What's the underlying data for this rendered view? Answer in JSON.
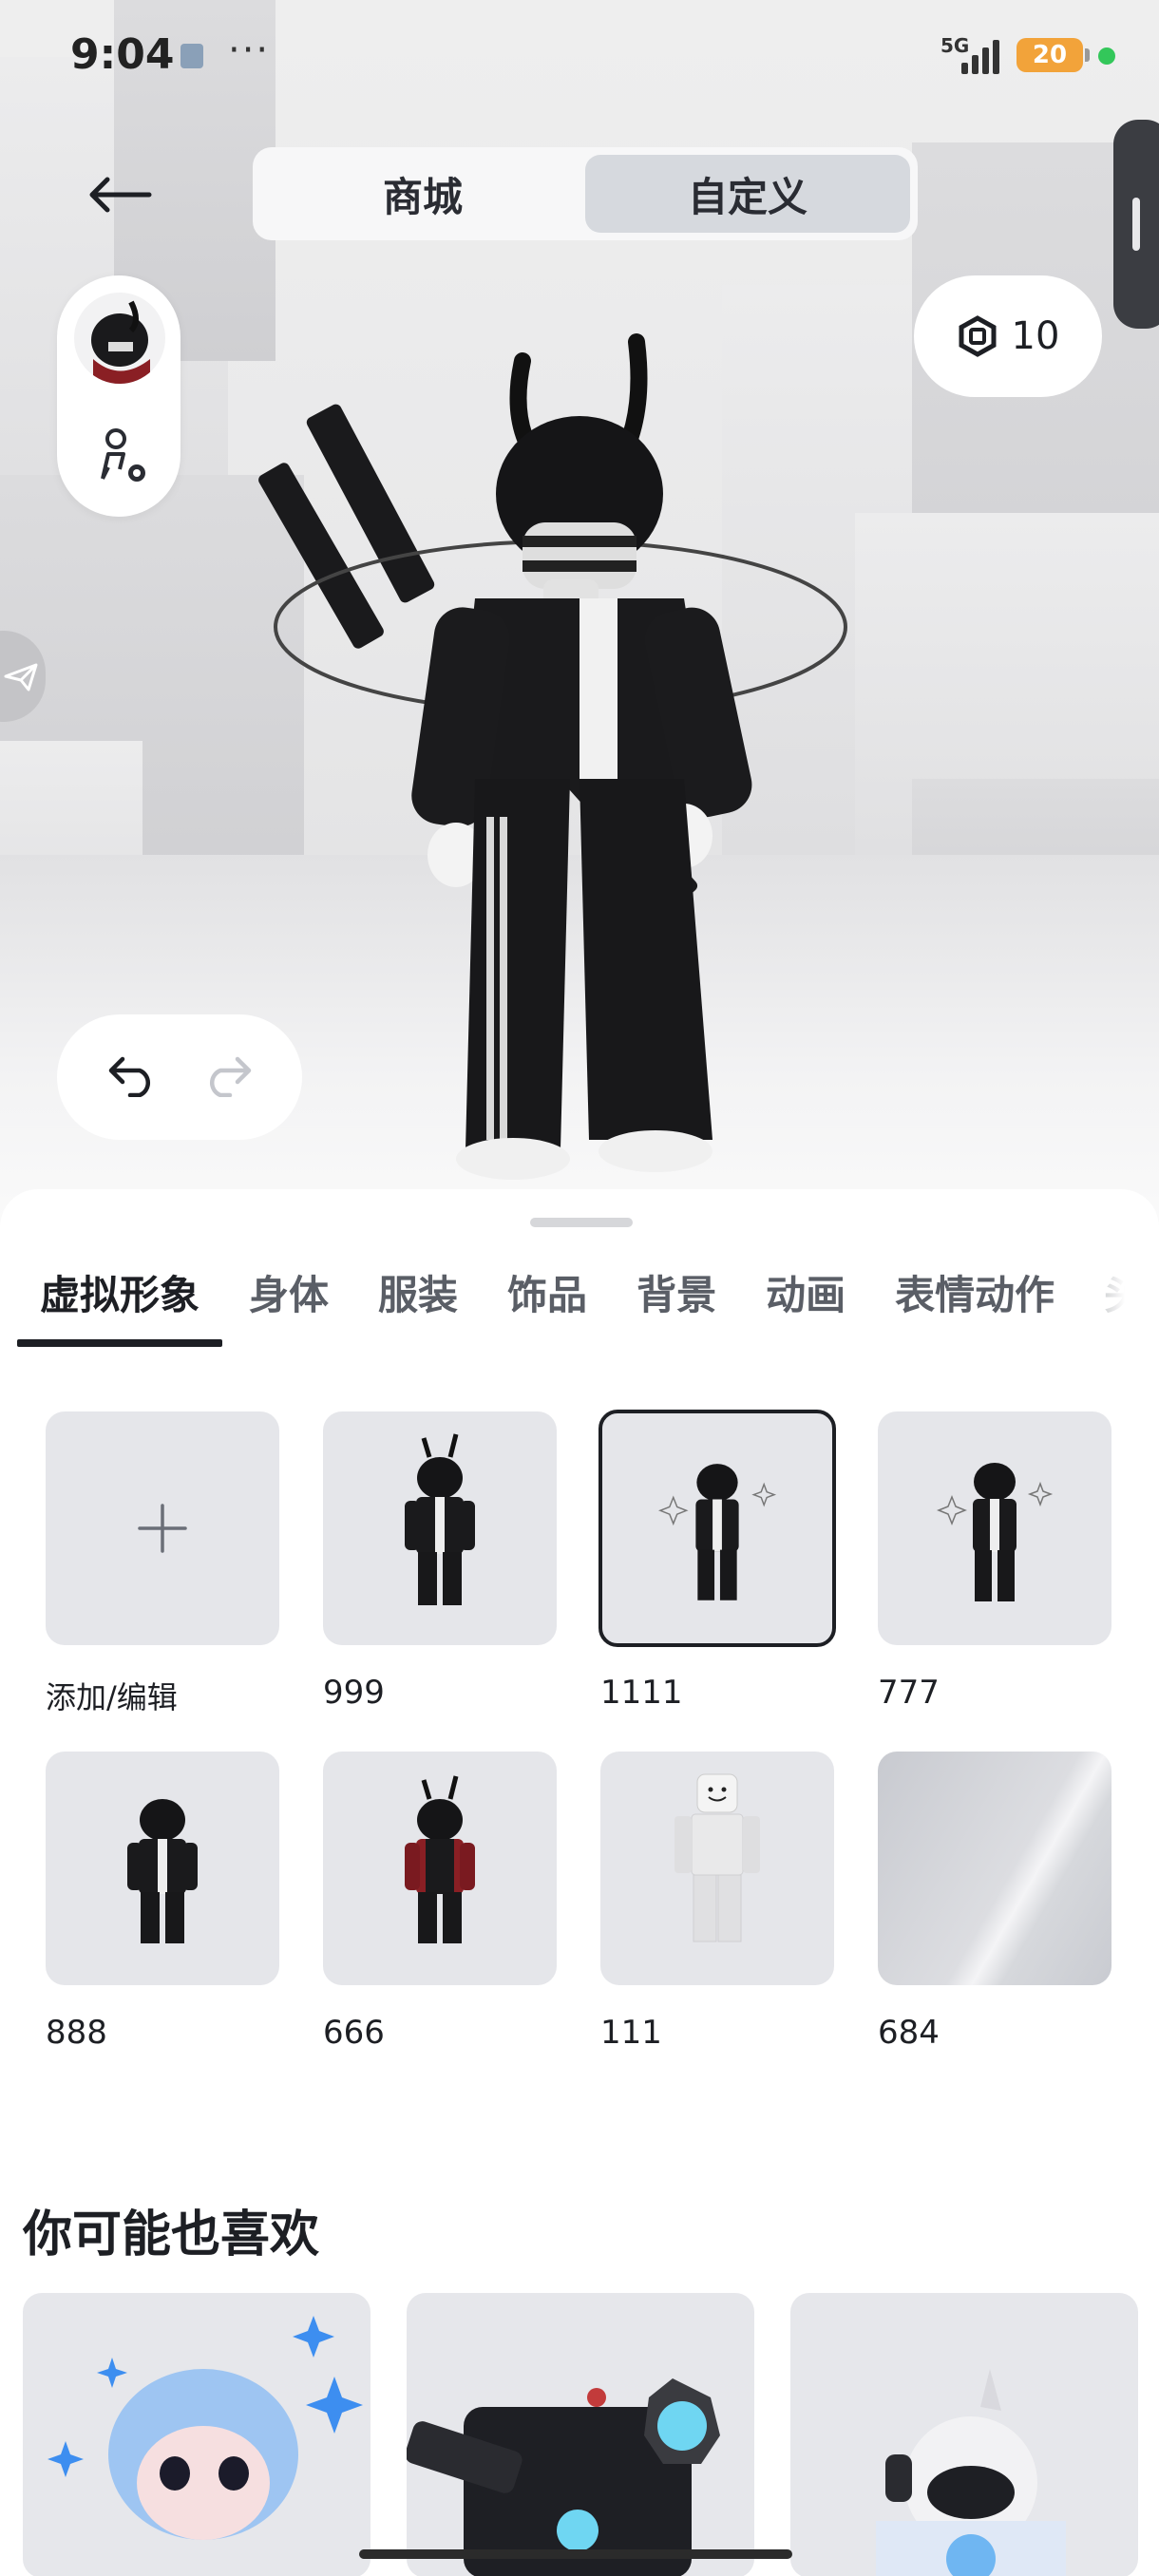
{
  "status_bar": {
    "time": "9:04",
    "more": "···",
    "network": "5G",
    "battery": "20"
  },
  "header": {
    "tabs": [
      {
        "label": "商城",
        "active": false
      },
      {
        "label": "自定义",
        "active": true
      }
    ],
    "robux_balance": "10"
  },
  "category_tabs": [
    {
      "label": "虚拟形象",
      "active": true
    },
    {
      "label": "身体",
      "active": false
    },
    {
      "label": "服装",
      "active": false
    },
    {
      "label": "饰品",
      "active": false
    },
    {
      "label": "背景",
      "active": false
    },
    {
      "label": "动画",
      "active": false
    },
    {
      "label": "表情动作",
      "active": false
    },
    {
      "label": "头",
      "active": false
    }
  ],
  "avatars": {
    "add_label": "添加/编辑",
    "items": [
      {
        "label": "999",
        "selected": false
      },
      {
        "label": "1111",
        "selected": true
      },
      {
        "label": "777",
        "selected": false
      },
      {
        "label": "888",
        "selected": false
      },
      {
        "label": "666",
        "selected": false
      },
      {
        "label": "111",
        "selected": false
      },
      {
        "label": "684",
        "selected": false
      }
    ]
  },
  "recommendations": {
    "title": "你可能也喜欢"
  },
  "colors": {
    "accent_dark": "#1d1f24",
    "tile_bg": "#e5e6ea",
    "segment_active": "#d6d9de",
    "battery": "#f2a33a",
    "status_green": "#33c75a"
  },
  "icons": {
    "back": "arrow-left-icon",
    "robux": "robux-hexagon-icon",
    "settings": "avatar-settings-icon",
    "undo": "undo-icon",
    "redo": "redo-icon",
    "add": "plus-icon"
  }
}
